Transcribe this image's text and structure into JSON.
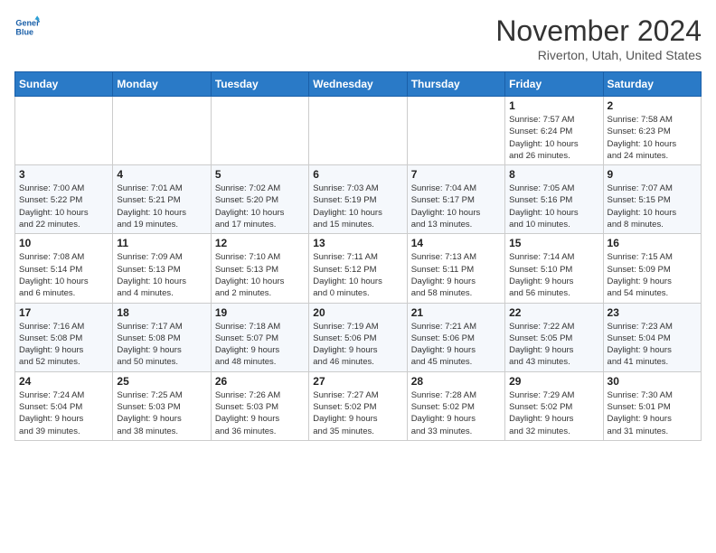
{
  "header": {
    "logo_line1": "General",
    "logo_line2": "Blue",
    "month_title": "November 2024",
    "location": "Riverton, Utah, United States"
  },
  "weekdays": [
    "Sunday",
    "Monday",
    "Tuesday",
    "Wednesday",
    "Thursday",
    "Friday",
    "Saturday"
  ],
  "weeks": [
    [
      {
        "day": "",
        "info": ""
      },
      {
        "day": "",
        "info": ""
      },
      {
        "day": "",
        "info": ""
      },
      {
        "day": "",
        "info": ""
      },
      {
        "day": "",
        "info": ""
      },
      {
        "day": "1",
        "info": "Sunrise: 7:57 AM\nSunset: 6:24 PM\nDaylight: 10 hours\nand 26 minutes."
      },
      {
        "day": "2",
        "info": "Sunrise: 7:58 AM\nSunset: 6:23 PM\nDaylight: 10 hours\nand 24 minutes."
      }
    ],
    [
      {
        "day": "3",
        "info": "Sunrise: 7:00 AM\nSunset: 5:22 PM\nDaylight: 10 hours\nand 22 minutes."
      },
      {
        "day": "4",
        "info": "Sunrise: 7:01 AM\nSunset: 5:21 PM\nDaylight: 10 hours\nand 19 minutes."
      },
      {
        "day": "5",
        "info": "Sunrise: 7:02 AM\nSunset: 5:20 PM\nDaylight: 10 hours\nand 17 minutes."
      },
      {
        "day": "6",
        "info": "Sunrise: 7:03 AM\nSunset: 5:19 PM\nDaylight: 10 hours\nand 15 minutes."
      },
      {
        "day": "7",
        "info": "Sunrise: 7:04 AM\nSunset: 5:17 PM\nDaylight: 10 hours\nand 13 minutes."
      },
      {
        "day": "8",
        "info": "Sunrise: 7:05 AM\nSunset: 5:16 PM\nDaylight: 10 hours\nand 10 minutes."
      },
      {
        "day": "9",
        "info": "Sunrise: 7:07 AM\nSunset: 5:15 PM\nDaylight: 10 hours\nand 8 minutes."
      }
    ],
    [
      {
        "day": "10",
        "info": "Sunrise: 7:08 AM\nSunset: 5:14 PM\nDaylight: 10 hours\nand 6 minutes."
      },
      {
        "day": "11",
        "info": "Sunrise: 7:09 AM\nSunset: 5:13 PM\nDaylight: 10 hours\nand 4 minutes."
      },
      {
        "day": "12",
        "info": "Sunrise: 7:10 AM\nSunset: 5:13 PM\nDaylight: 10 hours\nand 2 minutes."
      },
      {
        "day": "13",
        "info": "Sunrise: 7:11 AM\nSunset: 5:12 PM\nDaylight: 10 hours\nand 0 minutes."
      },
      {
        "day": "14",
        "info": "Sunrise: 7:13 AM\nSunset: 5:11 PM\nDaylight: 9 hours\nand 58 minutes."
      },
      {
        "day": "15",
        "info": "Sunrise: 7:14 AM\nSunset: 5:10 PM\nDaylight: 9 hours\nand 56 minutes."
      },
      {
        "day": "16",
        "info": "Sunrise: 7:15 AM\nSunset: 5:09 PM\nDaylight: 9 hours\nand 54 minutes."
      }
    ],
    [
      {
        "day": "17",
        "info": "Sunrise: 7:16 AM\nSunset: 5:08 PM\nDaylight: 9 hours\nand 52 minutes."
      },
      {
        "day": "18",
        "info": "Sunrise: 7:17 AM\nSunset: 5:08 PM\nDaylight: 9 hours\nand 50 minutes."
      },
      {
        "day": "19",
        "info": "Sunrise: 7:18 AM\nSunset: 5:07 PM\nDaylight: 9 hours\nand 48 minutes."
      },
      {
        "day": "20",
        "info": "Sunrise: 7:19 AM\nSunset: 5:06 PM\nDaylight: 9 hours\nand 46 minutes."
      },
      {
        "day": "21",
        "info": "Sunrise: 7:21 AM\nSunset: 5:06 PM\nDaylight: 9 hours\nand 45 minutes."
      },
      {
        "day": "22",
        "info": "Sunrise: 7:22 AM\nSunset: 5:05 PM\nDaylight: 9 hours\nand 43 minutes."
      },
      {
        "day": "23",
        "info": "Sunrise: 7:23 AM\nSunset: 5:04 PM\nDaylight: 9 hours\nand 41 minutes."
      }
    ],
    [
      {
        "day": "24",
        "info": "Sunrise: 7:24 AM\nSunset: 5:04 PM\nDaylight: 9 hours\nand 39 minutes."
      },
      {
        "day": "25",
        "info": "Sunrise: 7:25 AM\nSunset: 5:03 PM\nDaylight: 9 hours\nand 38 minutes."
      },
      {
        "day": "26",
        "info": "Sunrise: 7:26 AM\nSunset: 5:03 PM\nDaylight: 9 hours\nand 36 minutes."
      },
      {
        "day": "27",
        "info": "Sunrise: 7:27 AM\nSunset: 5:02 PM\nDaylight: 9 hours\nand 35 minutes."
      },
      {
        "day": "28",
        "info": "Sunrise: 7:28 AM\nSunset: 5:02 PM\nDaylight: 9 hours\nand 33 minutes."
      },
      {
        "day": "29",
        "info": "Sunrise: 7:29 AM\nSunset: 5:02 PM\nDaylight: 9 hours\nand 32 minutes."
      },
      {
        "day": "30",
        "info": "Sunrise: 7:30 AM\nSunset: 5:01 PM\nDaylight: 9 hours\nand 31 minutes."
      }
    ]
  ]
}
